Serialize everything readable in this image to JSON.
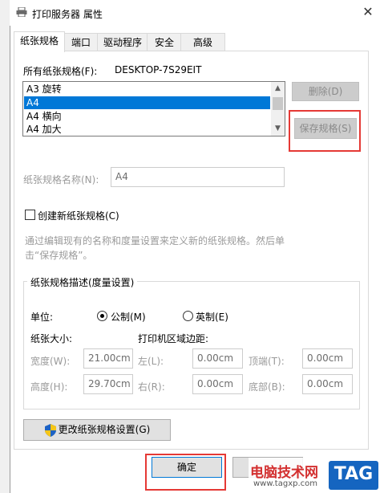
{
  "window": {
    "title": "打印服务器 属性",
    "close": "✕"
  },
  "tabs": [
    {
      "label": "纸张规格",
      "active": true
    },
    {
      "label": "端口",
      "active": false
    },
    {
      "label": "驱动程序",
      "active": false
    },
    {
      "label": "安全",
      "active": false
    },
    {
      "label": "高级",
      "active": false
    }
  ],
  "forms": {
    "label": "所有纸张规格(F):",
    "server": "DESKTOP-7S29EIT",
    "items": [
      "A3 旋转",
      "A4",
      "A4 横向",
      "A4 加大"
    ],
    "selected_index": 1
  },
  "buttons": {
    "delete": "删除(D)",
    "save": "保存规格(S)",
    "change": "更改纸张规格设置(G)",
    "ok": "确定"
  },
  "form_name": {
    "label": "纸张规格名称(N):",
    "value": "A4"
  },
  "create_new": {
    "label": "创建新纸张规格(C)",
    "checked": false
  },
  "help_text": {
    "line1": "通过编辑现有的名称和度量设置来定义新的纸张规格。然后单",
    "line2": "击“保存规格”。"
  },
  "description": {
    "group_title": "纸张规格描述(度量设置)",
    "units_label": "单位:",
    "unit_metric": "公制(M)",
    "unit_imperial": "英制(E)",
    "unit_selected": "metric",
    "paper_size_label": "纸张大小:",
    "margins_label": "打印机区域边距:",
    "width_label": "宽度(W):",
    "width_value": "21.00cm",
    "height_label": "高度(H):",
    "height_value": "29.70cm",
    "left_label": "左(L):",
    "left_value": "0.00cm",
    "right_label": "右(R):",
    "right_value": "0.00cm",
    "top_label": "顶端(T):",
    "top_value": "0.00cm",
    "bottom_label": "底部(B):",
    "bottom_value": "0.00cm"
  },
  "watermark": {
    "text": "电脑技术网",
    "url": "www.tagxp.com",
    "badge": "TAG"
  },
  "colors": {
    "selection": "#0078d7",
    "highlight": "#e53935"
  }
}
